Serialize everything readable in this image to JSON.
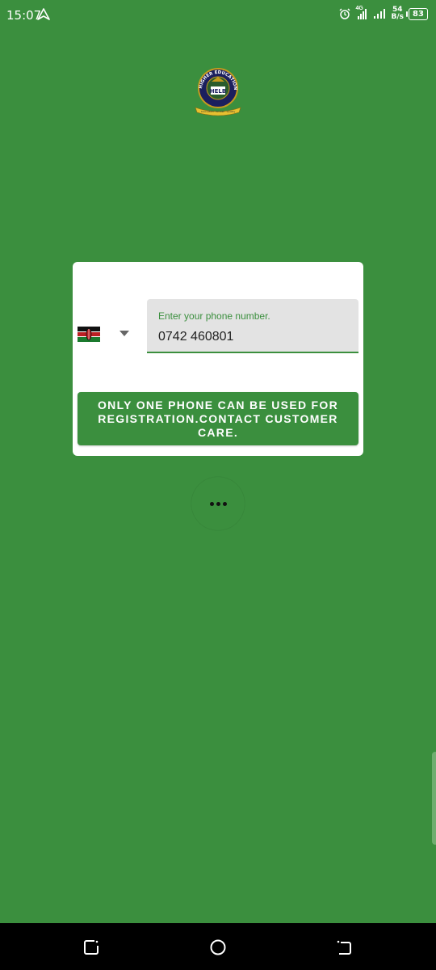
{
  "status_bar": {
    "time": "15:07",
    "network_type": "4G",
    "net_speed_value": "54",
    "net_speed_unit": "B/s",
    "battery": "83"
  },
  "logo": {
    "text_top": "HIGHER EDUCATION LOANS BOARD",
    "text_center": "HELB",
    "banner_text": "Innovation · Access · Quality"
  },
  "phone": {
    "country_flag": "kenya-flag",
    "label": "Enter your phone number.",
    "value": "0742 460801"
  },
  "register_button": {
    "label_line1": "ONLY ONE PHONE CAN BE USED FOR",
    "label_line2": "REGISTRATION.CONTACT CUSTOMER CARE."
  },
  "colors": {
    "background": "#3b8f3e",
    "card": "#ffffff",
    "field": "#e3e3e3",
    "accent": "#3b8f3e"
  }
}
